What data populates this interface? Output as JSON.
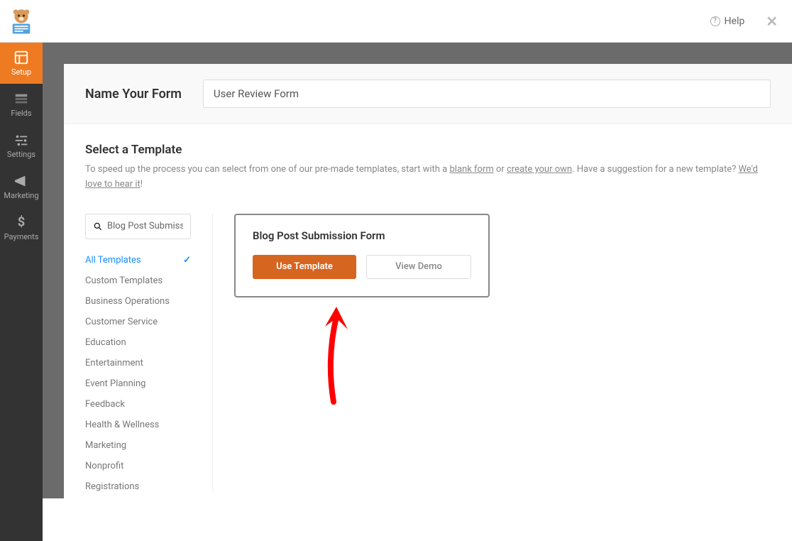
{
  "topbar": {
    "help_label": "Help"
  },
  "sidebar": {
    "items": [
      {
        "label": "Setup",
        "active": true
      },
      {
        "label": "Fields",
        "active": false
      },
      {
        "label": "Settings",
        "active": false
      },
      {
        "label": "Marketing",
        "active": false
      },
      {
        "label": "Payments",
        "active": false
      }
    ]
  },
  "form": {
    "name_label": "Name Your Form",
    "name_value": "User Review Form"
  },
  "template_section": {
    "title": "Select a Template",
    "sub_prefix": "To speed up the process you can select from one of our pre-made templates, start with a ",
    "link1": "blank form",
    "sub_or": " or ",
    "link2": "create your own",
    "sub_mid": ". Have a suggestion for a new template? ",
    "link3": "We'd love to hear it",
    "sub_end": "!"
  },
  "search": {
    "value": "Blog Post Submission"
  },
  "categories": [
    "All Templates",
    "Custom Templates",
    "Business Operations",
    "Customer Service",
    "Education",
    "Entertainment",
    "Event Planning",
    "Feedback",
    "Health & Wellness",
    "Marketing",
    "Nonprofit",
    "Registrations"
  ],
  "template_card": {
    "title": "Blog Post Submission Form",
    "use_btn": "Use Template",
    "demo_btn": "View Demo"
  }
}
